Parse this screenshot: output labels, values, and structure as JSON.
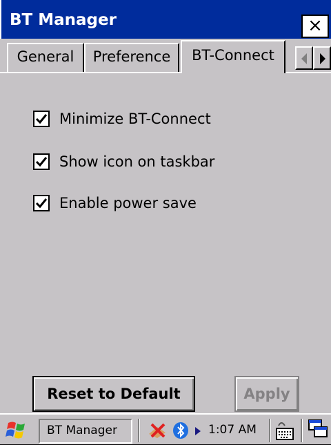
{
  "window": {
    "title": "BT Manager",
    "close_label": "×"
  },
  "tabs": [
    {
      "label": "General",
      "active": false
    },
    {
      "label": "Preference",
      "active": false
    },
    {
      "label": "BT-Connect",
      "active": true
    }
  ],
  "options": [
    {
      "label": "Minimize BT-Connect",
      "checked": true
    },
    {
      "label": "Show icon on taskbar",
      "checked": true
    },
    {
      "label": "Enable power save",
      "checked": true
    }
  ],
  "buttons": {
    "reset_label": "Reset to Default",
    "apply_label": "Apply"
  },
  "taskbar": {
    "task_label": "BT Manager",
    "clock": "1:07 AM",
    "icons": [
      "windows-start-icon",
      "network-icon",
      "bluetooth-icon",
      "tray-expand-icon",
      "keyboard-icon",
      "window-switch-icon"
    ]
  },
  "colors": {
    "titlebar": "#002c9c",
    "face": "#c6c3c6",
    "disabled_text": "#848284"
  }
}
